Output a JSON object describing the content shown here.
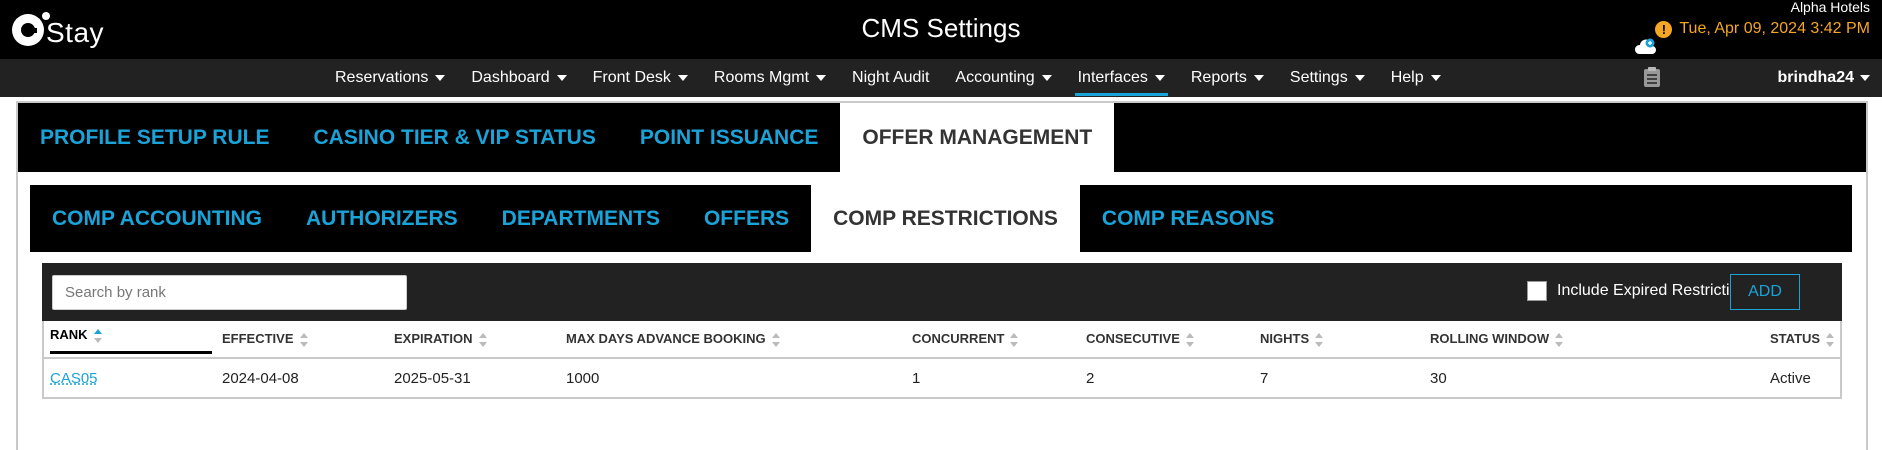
{
  "app": {
    "logo_text": "Stay",
    "title": "CMS Settings",
    "hotel": "Alpha Hotels",
    "datetime": "Tue, Apr 09, 2024 3:42 PM",
    "user": "brindha24"
  },
  "nav": {
    "items": [
      {
        "label": "Reservations",
        "dropdown": true
      },
      {
        "label": "Dashboard",
        "dropdown": true
      },
      {
        "label": "Front Desk",
        "dropdown": true
      },
      {
        "label": "Rooms Mgmt",
        "dropdown": true
      },
      {
        "label": "Night Audit",
        "dropdown": false
      },
      {
        "label": "Accounting",
        "dropdown": true
      },
      {
        "label": "Interfaces",
        "dropdown": true,
        "active": true
      },
      {
        "label": "Reports",
        "dropdown": true
      },
      {
        "label": "Settings",
        "dropdown": true
      },
      {
        "label": "Help",
        "dropdown": true
      }
    ]
  },
  "tabs_primary": [
    {
      "label": "PROFILE SETUP RULE"
    },
    {
      "label": "CASINO TIER & VIP STATUS"
    },
    {
      "label": "POINT ISSUANCE"
    },
    {
      "label": "OFFER MANAGEMENT",
      "active": true
    }
  ],
  "tabs_secondary": [
    {
      "label": "COMP ACCOUNTING"
    },
    {
      "label": "AUTHORIZERS"
    },
    {
      "label": "DEPARTMENTS"
    },
    {
      "label": "OFFERS"
    },
    {
      "label": "COMP RESTRICTIONS",
      "active": true
    },
    {
      "label": "COMP REASONS"
    }
  ],
  "filter": {
    "search_placeholder": "Search by rank",
    "search_value": "",
    "include_expired_label": "Include Expired Restrictions",
    "include_expired_checked": false,
    "add_label": "ADD"
  },
  "table": {
    "columns": [
      {
        "label": "RANK",
        "sorted": "asc"
      },
      {
        "label": "EFFECTIVE"
      },
      {
        "label": "EXPIRATION"
      },
      {
        "label": "MAX DAYS ADVANCE BOOKING"
      },
      {
        "label": "CONCURRENT"
      },
      {
        "label": "CONSECUTIVE"
      },
      {
        "label": "NIGHTS"
      },
      {
        "label": "ROLLING WINDOW"
      },
      {
        "label": "STATUS"
      }
    ],
    "rows": [
      [
        "CAS05",
        "2024-04-08",
        "2025-05-31",
        "1000",
        "1",
        "2",
        "7",
        "30",
        "Active"
      ]
    ]
  },
  "colors": {
    "accent": "#1aa3d9",
    "warning": "#f5a623",
    "header_bg": "#000000",
    "nav_bg": "#222222"
  },
  "icons": {
    "warning": "warning-icon",
    "cloud": "cloud-sync-icon",
    "clipboard": "clipboard-icon",
    "caret": "caret-down-icon",
    "sort": "sort-icon"
  }
}
